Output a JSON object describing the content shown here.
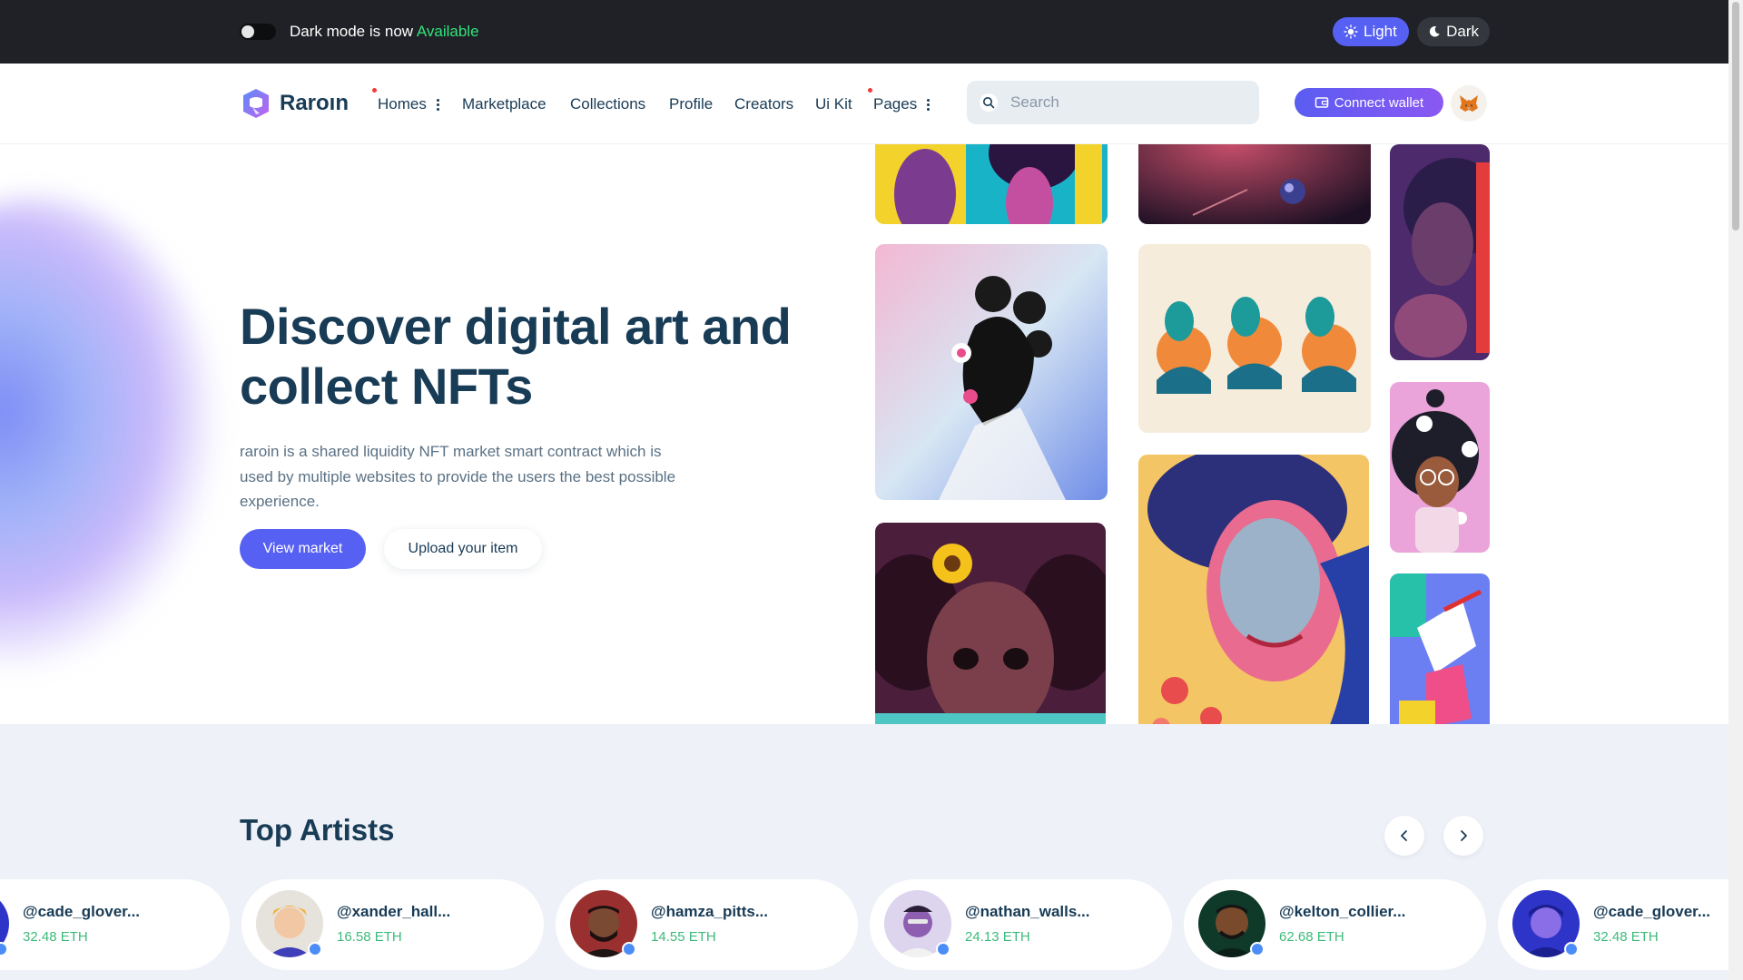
{
  "topbar": {
    "dark_mode_text": "Dark mode is now",
    "dark_mode_accent": "Available",
    "light_label": "Light",
    "dark_label": "Dark"
  },
  "nav": {
    "logo_text": "Raroın",
    "items": [
      "Homes",
      "Marketplace",
      "Collections",
      "Profile",
      "Creators",
      "Ui Kit",
      "Pages"
    ],
    "search_placeholder": "Search",
    "connect_label": "Connect wallet"
  },
  "hero": {
    "title_line1": "Discover digital art and",
    "title_line2": "collect NFTs",
    "description": "raroin is a shared liquidity NFT market smart contract which is used by multiple websites to provide the users the best possible experience.",
    "primary_button": "View market",
    "secondary_button": "Upload your item"
  },
  "top_artists": {
    "title": "Top Artists",
    "artists": [
      {
        "name": "@cade_glover...",
        "eth": "32.48 ETH"
      },
      {
        "name": "@xander_hall...",
        "eth": "16.58 ETH"
      },
      {
        "name": "@hamza_pitts...",
        "eth": "14.55 ETH"
      },
      {
        "name": "@nathan_walls...",
        "eth": "24.13 ETH"
      },
      {
        "name": "@kelton_collier...",
        "eth": "62.68 ETH"
      },
      {
        "name": "@cade_glover...",
        "eth": "32.48 ETH"
      }
    ]
  },
  "colors": {
    "accent": "#5660f3",
    "available_green": "#32e37b",
    "eth_green": "#3dba7a",
    "heading": "#183b56",
    "topbar_bg": "#1f2126"
  }
}
